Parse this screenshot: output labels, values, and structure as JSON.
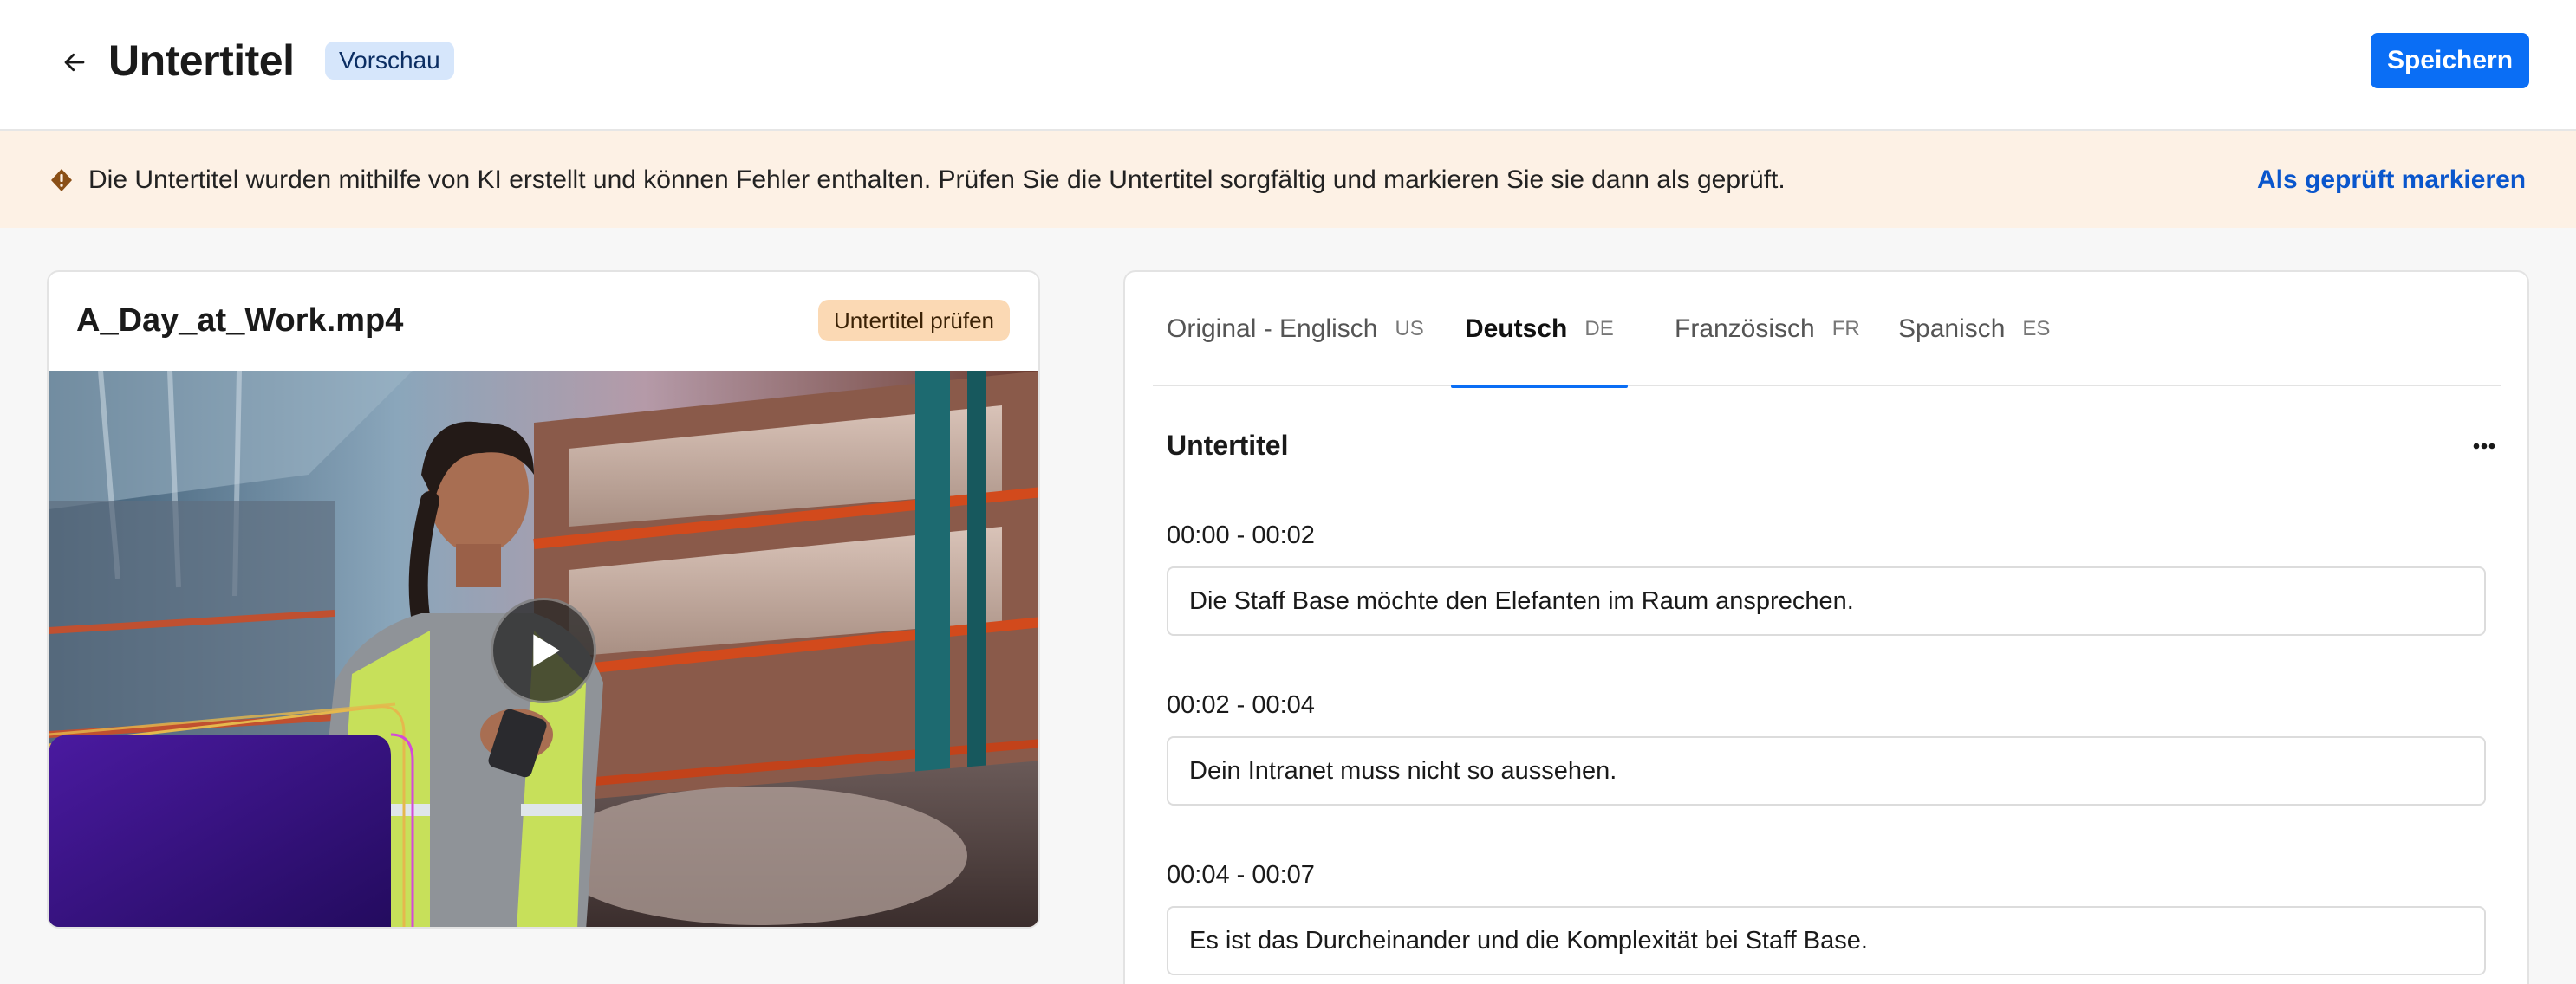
{
  "header": {
    "title": "Untertitel",
    "badge": "Vorschau",
    "save_label": "Speichern"
  },
  "banner": {
    "message": "Die Untertitel wurden mithilfe von KI erstellt und können Fehler enthalten. Prüfen Sie die Untertitel sorgfältig und markieren Sie sie dann als geprüft.",
    "action_label": "Als geprüft markieren"
  },
  "video": {
    "filename": "A_Day_at_Work.mp4",
    "status_badge": "Untertitel prüfen"
  },
  "subtitles": {
    "tabs": [
      {
        "label": "Original - Englisch",
        "code": "US",
        "active": false
      },
      {
        "label": "Deutsch",
        "code": "DE",
        "active": true
      },
      {
        "label": "Französisch",
        "code": "FR",
        "active": false
      },
      {
        "label": "Spanisch",
        "code": "ES",
        "active": false
      }
    ],
    "heading": "Untertitel",
    "cues": [
      {
        "time": "00:00 - 00:02",
        "text": "Die Staff Base möchte den Elefanten im Raum ansprechen."
      },
      {
        "time": "00:02 - 00:04",
        "text": "Dein Intranet muss nicht so aussehen."
      },
      {
        "time": "00:04 - 00:07",
        "text": "Es ist das Durcheinander und die Komplexität bei Staff Base."
      }
    ]
  },
  "icons": {
    "back": "arrow-left-icon",
    "warning": "warning-diamond-icon",
    "play": "play-icon",
    "more": "more-horizontal-icon"
  },
  "colors": {
    "primary": "#0a6ef5",
    "banner_bg": "#fdf1e5",
    "preview_badge_bg": "#d6e6fb",
    "review_badge_bg": "#fbd9b4"
  }
}
